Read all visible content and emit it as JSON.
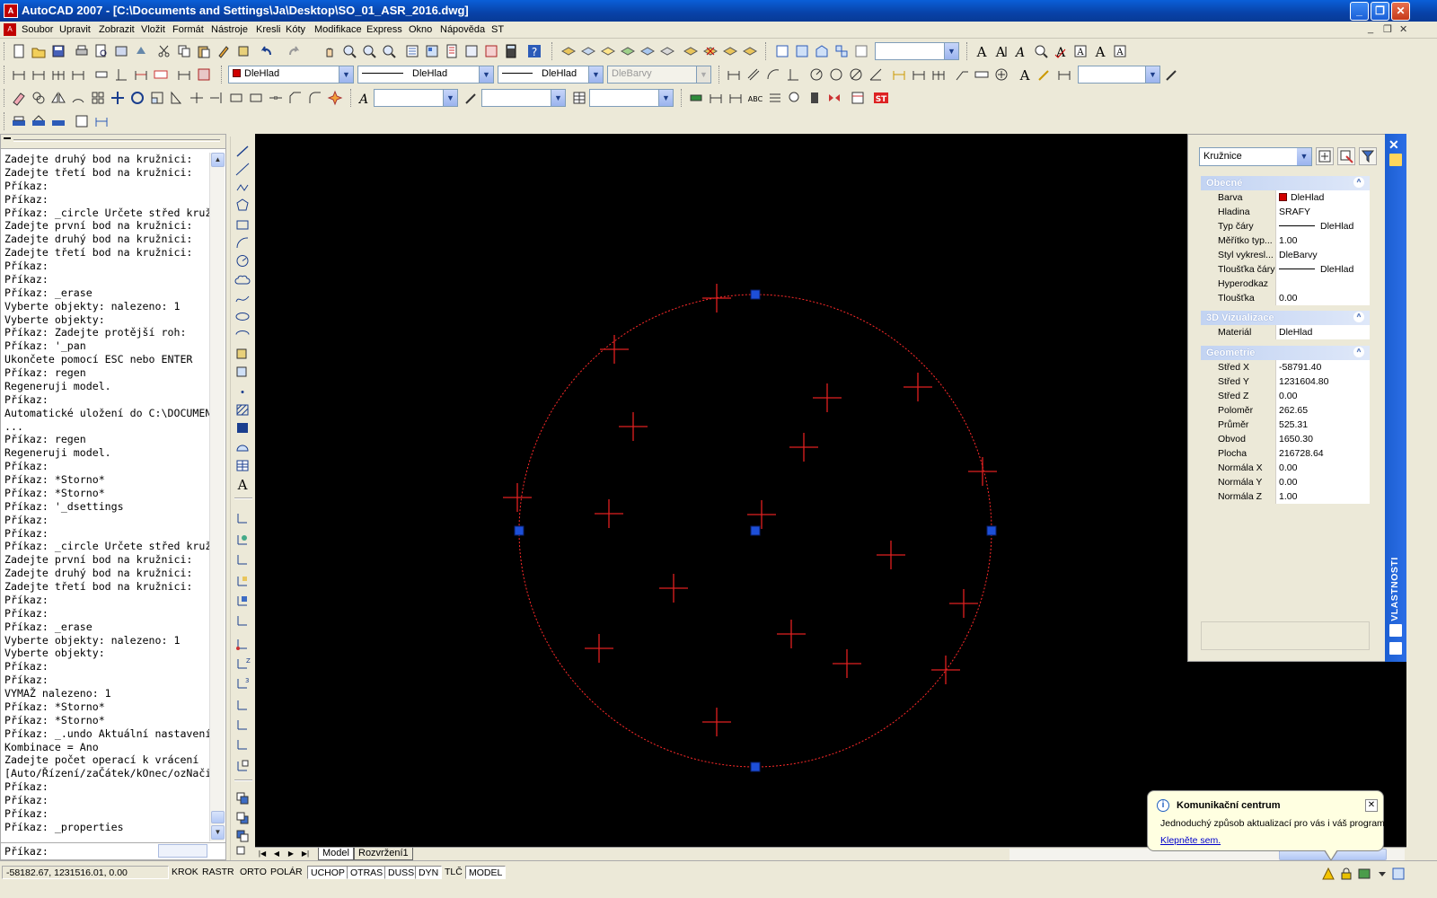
{
  "window": {
    "title": "AutoCAD 2007 - [C:\\Documents and Settings\\Ja\\Desktop\\SO_01_ASR_2016.dwg]",
    "app_icon_text": "A",
    "minimize": "_",
    "restore": "❐",
    "close": "✕"
  },
  "menu": {
    "items": [
      "Soubor",
      "Upravit",
      "Zobrazit",
      "Vložit",
      "Formát",
      "Nástroje",
      "Kresli",
      "Kóty",
      "Modifikace",
      "Express",
      "Okno",
      "Nápověda",
      "ST"
    ],
    "mdi_controls": [
      "_",
      "❐",
      "✕"
    ]
  },
  "toolbar": {
    "layer_color": "DleHlad",
    "linetype": "DleHlad",
    "lineweight": "DleHlad",
    "plotstyle": "DleBarvy",
    "color_accent": "#d00000"
  },
  "command": {
    "lines": [
      "Zadejte druhý bod na kružnici:",
      "Zadejte třetí bod na kružnici:",
      "Příkaz:",
      "Příkaz:",
      "Příkaz: _circle Určete střed kružnice",
      "Zadejte první bod na kružnici:",
      "Zadejte druhý bod na kružnici:",
      "Zadejte třetí bod na kružnici:",
      "Příkaz:",
      "Příkaz:",
      "Příkaz: _erase",
      "Vyberte objekty: nalezeno: 1",
      "Vyberte objekty:",
      "Příkaz: Zadejte protější roh:",
      "Příkaz: '_pan",
      "Ukončete pomocí ESC nebo ENTER",
      "Příkaz: regen",
      "Regeneruji model.",
      "Příkaz:",
      "Automatické uložení do C:\\DOCUMENTS",
      "...",
      "Příkaz: regen",
      "Regeneruji model.",
      "Příkaz:",
      "Příkaz: *Storno*",
      "Příkaz: *Storno*",
      "Příkaz: '_dsettings",
      "Příkaz:",
      "Příkaz:",
      "Příkaz: _circle Určete střed kružnice",
      "Zadejte první bod na kružnici:",
      "Zadejte druhý bod na kružnici:",
      "Zadejte třetí bod na kružnici:",
      "Příkaz:",
      "Příkaz:",
      "Příkaz: _erase",
      "Vyberte objekty: nalezeno: 1",
      "Vyberte objekty:",
      "Příkaz:",
      "Příkaz:",
      "VYMAŽ nalezeno: 1",
      "Příkaz: *Storno*",
      "Příkaz: *Storno*",
      "Příkaz: _.undo Aktuální nastavení",
      "Kombinace = Ano",
      "Zadejte počet operací k vrácení",
      "[Auto/Řízení/zaČátek/kOnec/ozNačit",
      "Příkaz:",
      "Příkaz:",
      "Příkaz:",
      "Příkaz: _properties"
    ],
    "prompt": "Příkaz:"
  },
  "layout_tabs": [
    "Model",
    "Rozvržení1"
  ],
  "status": {
    "coords": "-58182.67, 1231516.01, 0.00",
    "toggles": [
      {
        "label": "KROK",
        "on": false
      },
      {
        "label": "RASTR",
        "on": false
      },
      {
        "label": "ORTO",
        "on": false
      },
      {
        "label": "POLÁR",
        "on": false
      },
      {
        "label": "UCHOP",
        "on": true
      },
      {
        "label": "OTRAS",
        "on": true
      },
      {
        "label": "DUSS",
        "on": true
      },
      {
        "label": "DYN",
        "on": true
      },
      {
        "label": "TLČ",
        "on": false
      },
      {
        "label": "MODEL",
        "on": true
      }
    ]
  },
  "properties": {
    "object_type": "Kružnice",
    "strip_title": "VLASTNOSTI",
    "sections": {
      "general": {
        "title": "Obecné",
        "rows": [
          {
            "k": "Barva",
            "v": "DleHlad"
          },
          {
            "k": "Hladina",
            "v": "SRAFY"
          },
          {
            "k": "Typ čáry",
            "v": "DleHlad"
          },
          {
            "k": "Měřítko typ...",
            "v": "1.00"
          },
          {
            "k": "Styl vykresl...",
            "v": "DleBarvy"
          },
          {
            "k": "Tloušťka čáry",
            "v": "DleHlad"
          },
          {
            "k": "Hyperodkaz",
            "v": ""
          },
          {
            "k": "Tloušťka",
            "v": "0.00"
          }
        ]
      },
      "viz3d": {
        "title": "3D Vizualizace",
        "rows": [
          {
            "k": "Materiál",
            "v": "DleHlad"
          }
        ]
      },
      "geometry": {
        "title": "Geometrie",
        "rows": [
          {
            "k": "Střed X",
            "v": "-58791.40"
          },
          {
            "k": "Střed Y",
            "v": "1231604.80"
          },
          {
            "k": "Střed Z",
            "v": "0.00"
          },
          {
            "k": "Poloměr",
            "v": "262.65"
          },
          {
            "k": "Průměr",
            "v": "525.31"
          },
          {
            "k": "Obvod",
            "v": "1650.30"
          },
          {
            "k": "Plocha",
            "v": "216728.64"
          },
          {
            "k": "Normála X",
            "v": "0.00"
          },
          {
            "k": "Normála Y",
            "v": "0.00"
          },
          {
            "k": "Normála Z",
            "v": "1.00"
          }
        ]
      }
    }
  },
  "balloon": {
    "title": "Komunikační centrum",
    "message": "Jednoduchý způsob aktualizací pro vás i váš program.",
    "link": "Klepněte sem."
  },
  "drawing": {
    "circle_color": "#ff2a2a",
    "grip_color": "#1d4fd8",
    "cross_color": "#e02020",
    "cross_count": 17
  }
}
